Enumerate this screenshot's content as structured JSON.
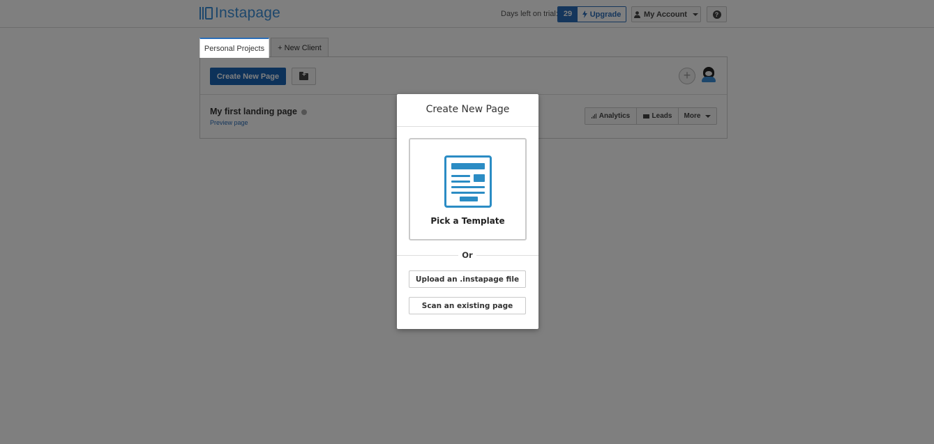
{
  "header": {
    "logo_text": "Instapage",
    "trial_label": "Days left on trial:",
    "trial_days": "29",
    "upgrade_label": "Upgrade",
    "account_label": "My Account",
    "help_label": "?"
  },
  "tabs": [
    {
      "label": "Personal Projects",
      "active": true
    },
    {
      "label": "+ New Client",
      "active": false
    }
  ],
  "toolbar": {
    "create_label": "Create New Page",
    "add_label": "+"
  },
  "page_item": {
    "title": "My first landing page",
    "preview_label": "Preview page",
    "analytics_label": "Analytics",
    "leads_label": "Leads",
    "more_label": "More"
  },
  "modal": {
    "title": "Create New Page",
    "template_label": "Pick a Template",
    "or_label": "Or",
    "upload_label": "Upload an .instapage file",
    "scan_label": "Scan an existing page"
  },
  "colors": {
    "accent": "#1b65b5",
    "logo": "#3b8fd9",
    "template_icon": "#2b8cc4"
  }
}
